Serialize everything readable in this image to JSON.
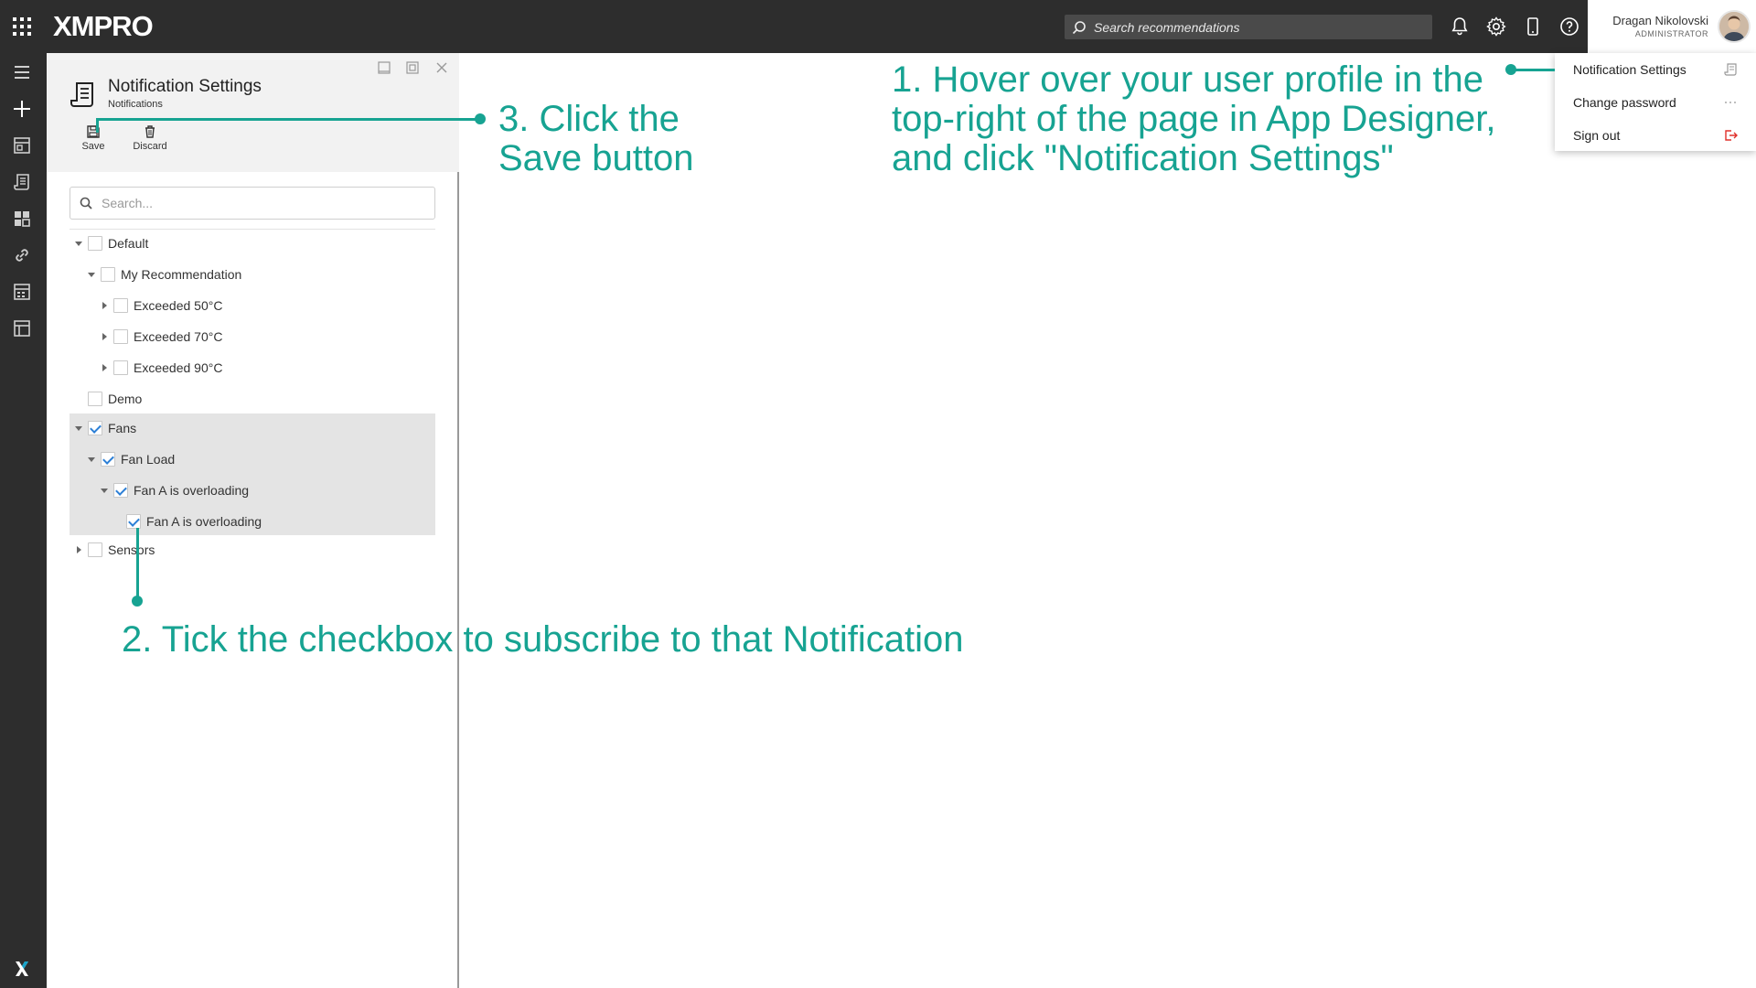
{
  "app": {
    "logo": "XMPRO"
  },
  "topbar": {
    "search_placeholder": "Search recommendations",
    "user_name": "Dragan Nikolovski",
    "user_role": "ADMINISTRATOR"
  },
  "user_menu": {
    "items": [
      {
        "label": "Notification Settings",
        "icon": "notification-doc-icon"
      },
      {
        "label": "Change password",
        "icon": "ellipsis-icon"
      },
      {
        "label": "Sign out",
        "icon": "sign-out-icon"
      }
    ]
  },
  "panel": {
    "title": "Notification Settings",
    "subtitle": "Notifications",
    "toolbar": {
      "save_label": "Save",
      "discard_label": "Discard"
    },
    "search_placeholder": "Search...",
    "tree": [
      {
        "label": "Default",
        "expanded": true,
        "checked": false
      },
      {
        "label": "My Recommendation",
        "expanded": true,
        "checked": false
      },
      {
        "label": "Exceeded 50°C",
        "expanded": false,
        "checked": false
      },
      {
        "label": "Exceeded 70°C",
        "expanded": false,
        "checked": false
      },
      {
        "label": "Exceeded 90°C",
        "expanded": false,
        "checked": false
      },
      {
        "label": "Demo",
        "expanded": null,
        "checked": false
      },
      {
        "label": "Fans",
        "expanded": true,
        "checked": true
      },
      {
        "label": "Fan Load",
        "expanded": true,
        "checked": true
      },
      {
        "label": "Fan A is overloading",
        "expanded": true,
        "checked": true
      },
      {
        "label": "Fan A is overloading",
        "expanded": null,
        "checked": true
      },
      {
        "label": "Sensors",
        "expanded": false,
        "checked": false
      }
    ]
  },
  "annotations": {
    "step1_line1": "1. Hover over your user profile in the",
    "step1_line2": "top-right of the page in App Designer,",
    "step1_line3": "and click \"Notification Settings\"",
    "step2": "2. Tick the checkbox to subscribe to that Notification",
    "step3_line1": "3. Click the",
    "step3_line2": "Save button"
  },
  "colors": {
    "accent": "#17a392",
    "topbar": "#2d2d2d",
    "check": "#2c7fd6",
    "signout": "#e0312c"
  }
}
